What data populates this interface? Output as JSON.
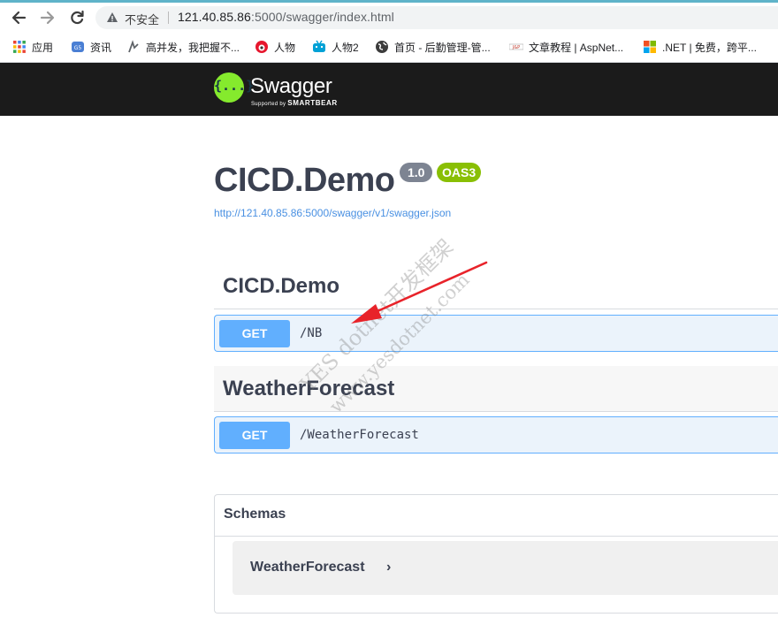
{
  "browser": {
    "back_icon": "arrow-left-icon",
    "forward_icon": "arrow-right-icon",
    "reload_icon": "reload-icon",
    "security_label": "不安全",
    "url_host": "121.40.85.86",
    "url_path": ":5000/swagger/index.html"
  },
  "bookmarks": [
    {
      "label": "应用",
      "icon": "apps-grid-icon"
    },
    {
      "label": "资讯",
      "icon": "news-icon"
    },
    {
      "label": "高并发，我把握不...",
      "icon": "bookmark-icon"
    },
    {
      "label": "人物",
      "icon": "weibo-icon"
    },
    {
      "label": "人物2",
      "icon": "bilibili-icon"
    },
    {
      "label": "首页 - 后勤管理-管...",
      "icon": "globe-icon"
    },
    {
      "label": "文章教程 | AspNet...",
      "icon": "site-icon"
    },
    {
      "label": ".NET | 免费，跨平...",
      "icon": "microsoft-icon"
    }
  ],
  "swagger": {
    "logo_glyph": "{...}",
    "brand": "Swagger",
    "supported_by": "Supported by",
    "smartbear": "SMARTBEAR"
  },
  "info": {
    "title": "CICD.Demo",
    "version": "1.0",
    "oas": "OAS3",
    "spec_url": "http://121.40.85.86:5000/swagger/v1/swagger.json"
  },
  "tags": [
    {
      "name": "CICD.Demo",
      "operations": [
        {
          "method": "GET",
          "path": "/NB"
        }
      ]
    },
    {
      "name": "WeatherForecast",
      "operations": [
        {
          "method": "GET",
          "path": "/WeatherForecast"
        }
      ]
    }
  ],
  "schemas": {
    "title": "Schemas",
    "models": [
      {
        "name": "WeatherForecast",
        "expand_glyph": "›"
      }
    ]
  },
  "watermark": {
    "line1": "YES dotnet开发框架",
    "line2": "www.yesdotnet.com"
  },
  "colors": {
    "get": "#61affe",
    "swagger_green": "#85ea2d",
    "oas_badge": "#89bf04",
    "annotation_arrow": "#e8232a"
  }
}
